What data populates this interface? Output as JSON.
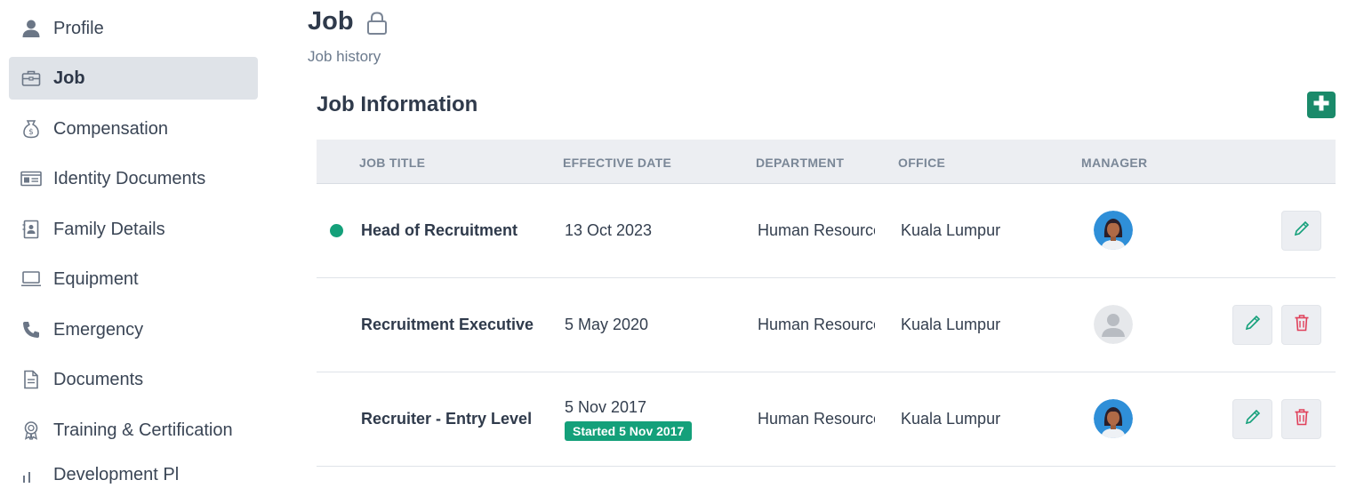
{
  "sidebar": {
    "items": [
      {
        "label": "Profile",
        "icon": "person-icon"
      },
      {
        "label": "Job",
        "icon": "briefcase-icon",
        "active": true
      },
      {
        "label": "Compensation",
        "icon": "money-bag-icon"
      },
      {
        "label": "Identity Documents",
        "icon": "id-card-icon"
      },
      {
        "label": "Family Details",
        "icon": "contact-book-icon"
      },
      {
        "label": "Equipment",
        "icon": "laptop-icon"
      },
      {
        "label": "Emergency",
        "icon": "phone-icon"
      },
      {
        "label": "Documents",
        "icon": "document-icon"
      },
      {
        "label": "Training & Certification",
        "icon": "award-icon"
      },
      {
        "label": "Development Pl",
        "icon": "development-icon"
      }
    ]
  },
  "header": {
    "title": "Job",
    "sub_link": "Job history"
  },
  "section": {
    "title": "Job Information"
  },
  "table": {
    "headers": {
      "job_title": "JOB TITLE",
      "effective_date": "EFFECTIVE DATE",
      "department": "DEPARTMENT",
      "office": "OFFICE",
      "manager": "MANAGER"
    },
    "rows": [
      {
        "current": true,
        "job_title": "Head of Recruitment",
        "effective_date": "13 Oct 2023",
        "department": "Human Resources",
        "office": "Kuala Lumpur",
        "manager_avatar": "woman-avatar",
        "can_delete": false,
        "badge": ""
      },
      {
        "current": false,
        "job_title": "Recruitment Executive",
        "effective_date": "5 May 2020",
        "department": "Human Resources",
        "office": "Kuala Lumpur",
        "manager_avatar": "placeholder-avatar",
        "can_delete": true,
        "badge": ""
      },
      {
        "current": false,
        "job_title": "Recruiter - Entry Level",
        "effective_date": "5 Nov 2017",
        "department": "Human Resources",
        "office": "Kuala Lumpur",
        "manager_avatar": "woman-avatar",
        "can_delete": true,
        "badge": "Started 5 Nov 2017"
      }
    ]
  },
  "colors": {
    "accent": "#14a07a",
    "add_button": "#1a8a6a",
    "delete": "#e0405a",
    "active_nav": "#dfe3e8"
  }
}
